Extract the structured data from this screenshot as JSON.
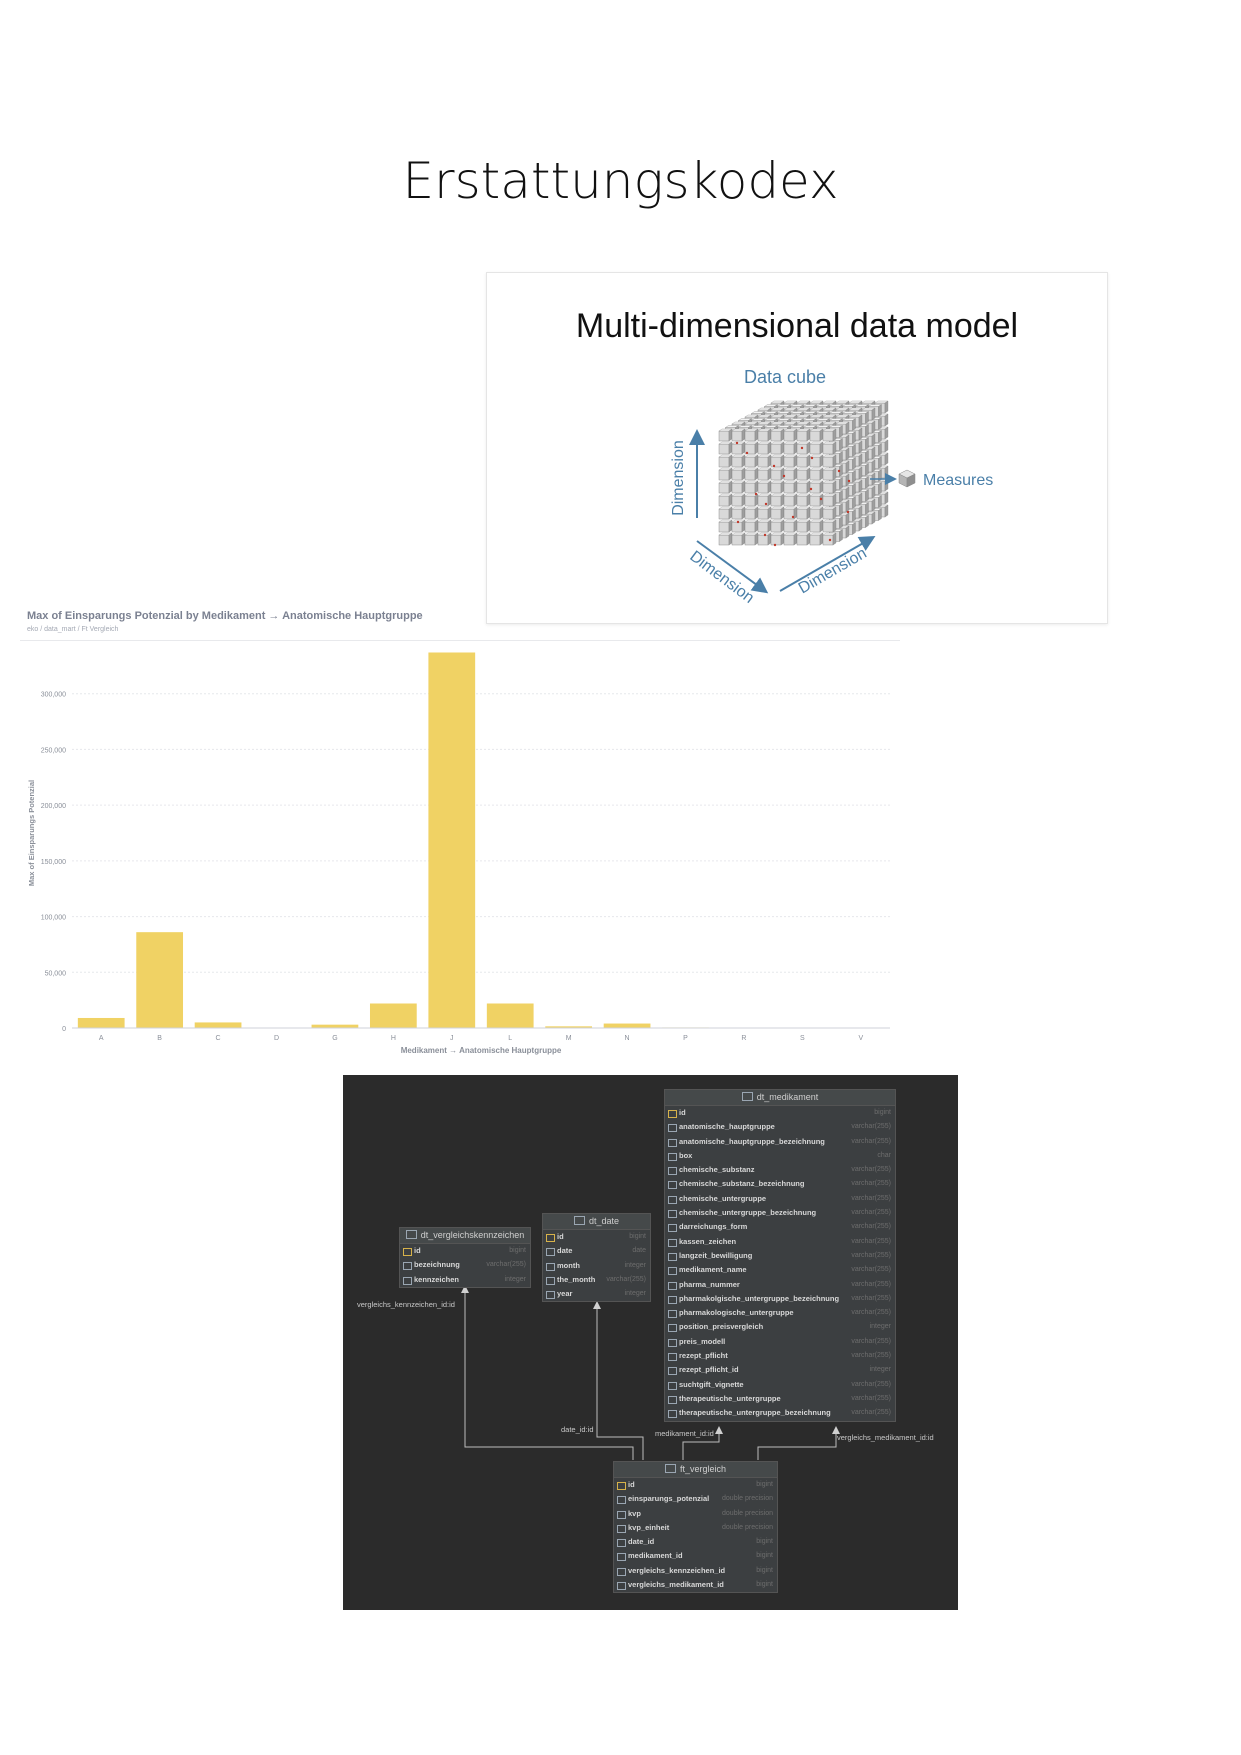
{
  "page_title": "Erstattungskodex",
  "cube_slide": {
    "heading": "Multi-dimensional data model",
    "subtitle": "Data cube",
    "dimension_left": "Dimension",
    "dimension_bottom_left": "Dimension",
    "dimension_bottom_right": "Dimension",
    "measures": "Measures",
    "colors": {
      "axis": "#4a7fa8",
      "text": "#111111"
    }
  },
  "chart": {
    "title": "Max of Einsparungs Potenzial by Medikament → Anatomische Hauptgruppe",
    "breadcrumb": "eko / data_mart / Ft Vergleich",
    "y_tick_labels": [
      "0",
      "50,000",
      "100,000",
      "150,000",
      "200,000",
      "250,000",
      "300,000"
    ]
  },
  "chart_data": {
    "type": "bar",
    "categories": [
      "A",
      "B",
      "C",
      "D",
      "G",
      "H",
      "J",
      "L",
      "M",
      "N",
      "P",
      "R",
      "S",
      "V"
    ],
    "values": [
      9000,
      86000,
      5000,
      300,
      3000,
      22000,
      337000,
      22000,
      1500,
      4000,
      500,
      300,
      300,
      300
    ],
    "title": "Max of Einsparungs Potenzial by Medikament → Anatomische Hauptgruppe",
    "xlabel": "Medikament → Anatomische Hauptgruppe",
    "ylabel": "Max of Einsparungs Potenzial",
    "ylim": [
      0,
      350000
    ],
    "yticks": [
      0,
      50000,
      100000,
      150000,
      200000,
      250000,
      300000
    ],
    "grid": true,
    "color": "#f0d264"
  },
  "erd": {
    "tables": {
      "dt_medikament": {
        "name": "dt_medikament",
        "columns": [
          {
            "name": "id",
            "type": "bigint"
          },
          {
            "name": "anatomische_hauptgruppe",
            "type": "varchar(255)"
          },
          {
            "name": "anatomische_hauptgruppe_bezeichnung",
            "type": "varchar(255)"
          },
          {
            "name": "box",
            "type": "char"
          },
          {
            "name": "chemische_substanz",
            "type": "varchar(255)"
          },
          {
            "name": "chemische_substanz_bezeichnung",
            "type": "varchar(255)"
          },
          {
            "name": "chemische_untergruppe",
            "type": "varchar(255)"
          },
          {
            "name": "chemische_untergruppe_bezeichnung",
            "type": "varchar(255)"
          },
          {
            "name": "darreichungs_form",
            "type": "varchar(255)"
          },
          {
            "name": "kassen_zeichen",
            "type": "varchar(255)"
          },
          {
            "name": "langzeit_bewilligung",
            "type": "varchar(255)"
          },
          {
            "name": "medikament_name",
            "type": "varchar(255)"
          },
          {
            "name": "pharma_nummer",
            "type": "varchar(255)"
          },
          {
            "name": "pharmakolgische_untergruppe_bezeichnung",
            "type": "varchar(255)"
          },
          {
            "name": "pharmakologische_untergruppe",
            "type": "varchar(255)"
          },
          {
            "name": "position_preisvergleich",
            "type": "integer"
          },
          {
            "name": "preis_modell",
            "type": "varchar(255)"
          },
          {
            "name": "rezept_pflicht",
            "type": "varchar(255)"
          },
          {
            "name": "rezept_pflicht_id",
            "type": "integer"
          },
          {
            "name": "suchtgift_vignette",
            "type": "varchar(255)"
          },
          {
            "name": "therapeutische_untergruppe",
            "type": "varchar(255)"
          },
          {
            "name": "therapeutische_untergruppe_bezeichnung",
            "type": "varchar(255)"
          }
        ]
      },
      "dt_vergleichskennzeichen": {
        "name": "dt_vergleichskennzeichen",
        "columns": [
          {
            "name": "id",
            "type": "bigint"
          },
          {
            "name": "bezeichnung",
            "type": "varchar(255)"
          },
          {
            "name": "kennzeichen",
            "type": "integer"
          }
        ]
      },
      "dt_date": {
        "name": "dt_date",
        "columns": [
          {
            "name": "id",
            "type": "bigint"
          },
          {
            "name": "date",
            "type": "date"
          },
          {
            "name": "month",
            "type": "integer"
          },
          {
            "name": "the_month",
            "type": "varchar(255)"
          },
          {
            "name": "year",
            "type": "integer"
          }
        ]
      },
      "ft_vergleich": {
        "name": "ft_vergleich",
        "columns": [
          {
            "name": "id",
            "type": "bigint"
          },
          {
            "name": "einsparungs_potenzial",
            "type": "double precision"
          },
          {
            "name": "kvp",
            "type": "double precision"
          },
          {
            "name": "kvp_einheit",
            "type": "double precision"
          },
          {
            "name": "date_id",
            "type": "bigint"
          },
          {
            "name": "medikament_id",
            "type": "bigint"
          },
          {
            "name": "vergleichs_kennzeichen_id",
            "type": "bigint"
          },
          {
            "name": "vergleichs_medikament_id",
            "type": "bigint"
          }
        ]
      }
    },
    "relations": {
      "vergleichs_kennzeichen": "vergleichs_kennzeichen_id:id",
      "date": "date_id:id",
      "medikament": "medikament_id:id",
      "vergleichs_medikament": "vergleichs_medikament_id:id"
    }
  }
}
